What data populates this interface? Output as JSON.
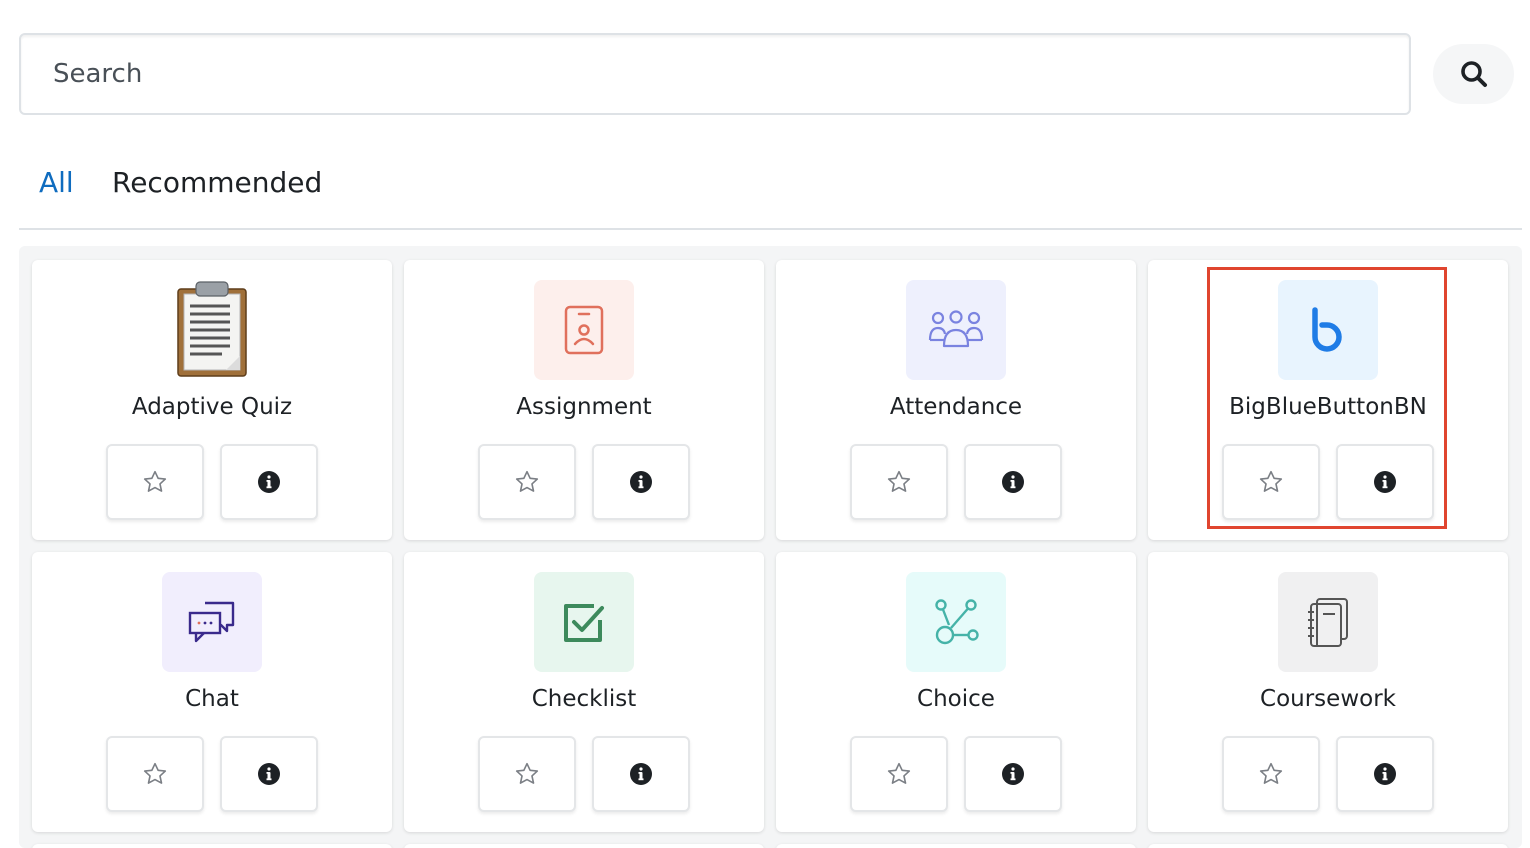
{
  "search": {
    "placeholder": "Search",
    "value": "",
    "button_icon": "search-icon"
  },
  "tabs": [
    {
      "label": "All",
      "active": true,
      "color": "#0f6cbf"
    },
    {
      "label": "Recommended",
      "active": false
    }
  ],
  "modules": [
    {
      "name": "Adaptive Quiz",
      "icon": "clipboard-icon",
      "icon_bg": "#ffffff"
    },
    {
      "name": "Assignment",
      "icon": "id-badge-icon",
      "icon_bg": "#fdefec",
      "icon_color": "#e0705c"
    },
    {
      "name": "Attendance",
      "icon": "group-icon",
      "icon_bg": "#eef0fd",
      "icon_color": "#7a83e0"
    },
    {
      "name": "BigBlueButtonBN",
      "icon": "bigbluebutton-icon",
      "icon_bg": "#e8f4fe",
      "icon_color": "#1f7ce6",
      "highlighted": true
    },
    {
      "name": "Chat",
      "icon": "chat-bubbles-icon",
      "icon_bg": "#f1eefd",
      "icon_color": "#3a2a8c"
    },
    {
      "name": "Checklist",
      "icon": "checkbox-icon",
      "icon_bg": "#e7f6ee",
      "icon_color": "#3d8a5c"
    },
    {
      "name": "Choice",
      "icon": "branch-icon",
      "icon_bg": "#e6fbfa",
      "icon_color": "#45b3a8"
    },
    {
      "name": "Coursework",
      "icon": "notebook-icon",
      "icon_bg": "#f0f0f1",
      "icon_color": "#555555"
    }
  ],
  "buttons": {
    "star_icon": "star-icon",
    "info_icon": "info-icon"
  },
  "highlight_color": "#e0452f"
}
